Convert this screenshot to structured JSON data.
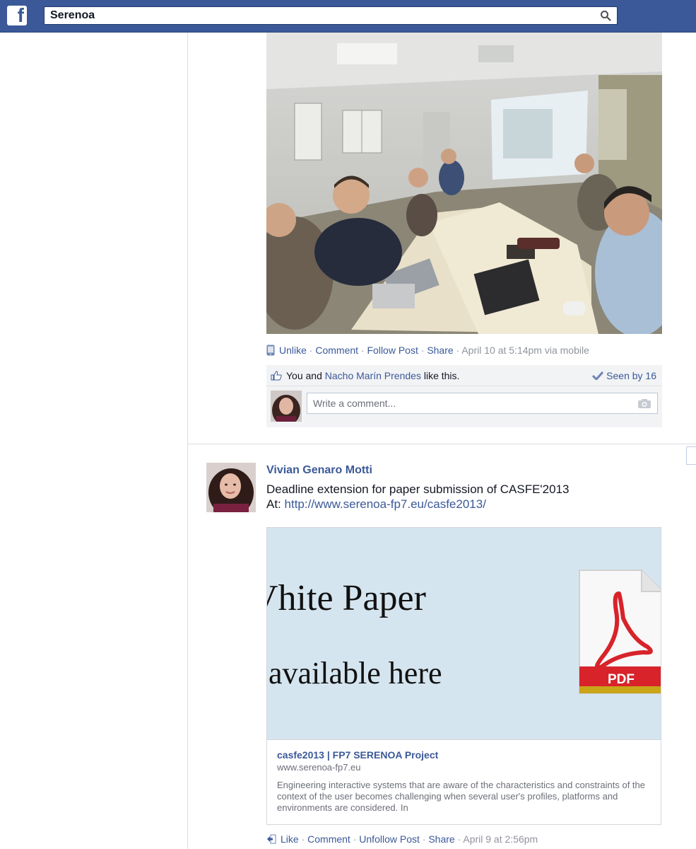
{
  "search": {
    "value": "Serenoa"
  },
  "post1": {
    "photo_alt": "",
    "actions": {
      "unlike": "Unlike",
      "comment": "Comment",
      "follow": "Follow Post",
      "share": "Share",
      "timestamp": "April 10 at 5:14pm via mobile"
    },
    "likes": {
      "prefix": "You and ",
      "person": "Nacho Marín Prendes",
      "suffix": " like this.",
      "seen": "Seen by 16"
    },
    "comment_placeholder": "Write a comment..."
  },
  "post2": {
    "author": "Vivian Genaro Motti",
    "text_line1": "Deadline extension for paper submission of CASFE'2013",
    "text_prefix": "At: ",
    "link": "http://www.serenoa-fp7.eu/casfe2013/",
    "card": {
      "image_line1": "Vhite Paper",
      "image_line2": "available here",
      "pdf_label": "PDF",
      "title": "casfe2013 | FP7 SERENOA Project",
      "domain": "www.serenoa-fp7.eu",
      "description": "Engineering interactive systems that are aware of the characteristics and constraints of the context of the user becomes challenging when several user's profiles, platforms and environments are considered. In"
    },
    "actions": {
      "like": "Like",
      "comment": "Comment",
      "unfollow": "Unfollow Post",
      "share": "Share",
      "timestamp": "April 9 at 2:56pm"
    }
  },
  "colors": {
    "brand": "#3b5998",
    "link": "#3b5998",
    "meta": "#90949c"
  },
  "icons": [
    "facebook-logo-icon",
    "search-icon",
    "mobile-icon",
    "thumbs-up-icon",
    "check-icon",
    "camera-icon",
    "pdf-icon",
    "share-icon"
  ]
}
